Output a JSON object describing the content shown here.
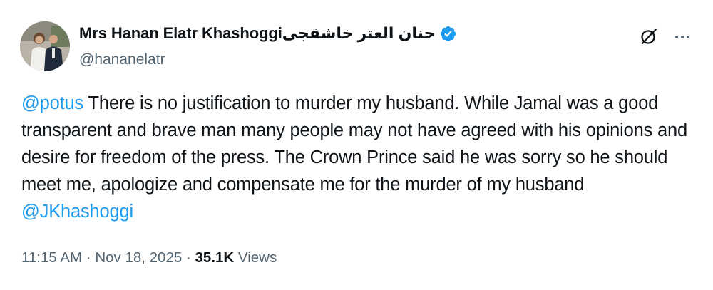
{
  "author": {
    "display_name": "Mrs Hanan Elatr Khashoggiحنان العتر خاشقجى",
    "handle": "@hananelatr",
    "verified": true,
    "verified_color": "#1d9bf0"
  },
  "header_actions": {
    "grok_icon": "grok-icon",
    "more_icon": "more-icon"
  },
  "tweet": {
    "mention_1": "@potus",
    "body_1": " There is no justification to murder my husband. While Jamal was a good transparent and brave man many people may not have agreed with his opinions and desire for freedom of the press. The Crown Prince said he was sorry so he should meet me, apologize and compensate me for the murder of my husband ",
    "mention_2": "@JKhashoggi"
  },
  "meta": {
    "time": "11:15 AM",
    "sep1": " · ",
    "date": "Nov 18, 2025",
    "sep2": " · ",
    "views_count": "35.1K",
    "views_label": " Views"
  },
  "colors": {
    "link": "#1d9bf0",
    "secondary_text": "#536471",
    "primary_text": "#0f1419"
  }
}
